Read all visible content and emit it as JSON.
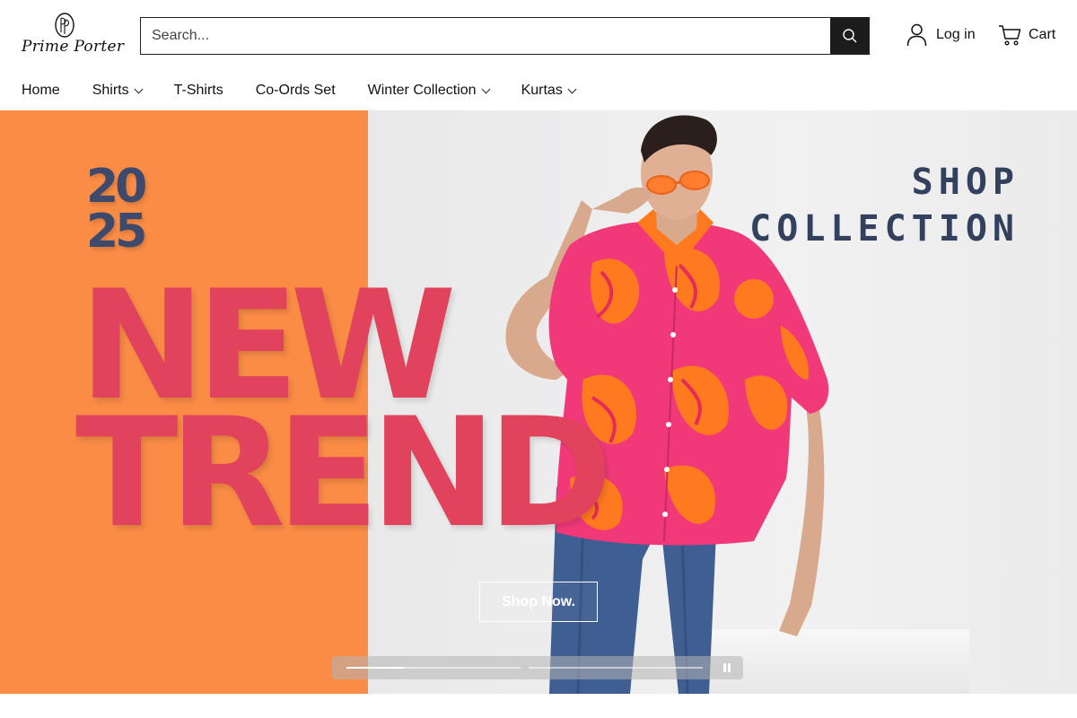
{
  "brand": {
    "name": "Prime Porter",
    "monogram": "PP"
  },
  "search": {
    "placeholder": "Search..."
  },
  "header": {
    "login_label": "Log in",
    "cart_label": "Cart"
  },
  "nav": {
    "items": [
      {
        "label": "Home"
      },
      {
        "label": "Shirts"
      },
      {
        "label": "T-Shirts"
      },
      {
        "label": "Co-Ords Set"
      },
      {
        "label": "Winter Collection"
      },
      {
        "label": "Kurtas"
      }
    ]
  },
  "hero": {
    "year_top": "20",
    "year_bottom": "25",
    "headline_line1": "NEW",
    "headline_line2": "TREND",
    "tag_line1": "SHOP",
    "tag_line2": "COLLECTION",
    "cta_label": "Shop Now.",
    "slides": {
      "count": 2,
      "current": 1,
      "progress": 0.33
    }
  },
  "colors": {
    "hero_left": "#fa8c46",
    "headline": "#e0435b",
    "accent_navy": "#33415e",
    "search_button": "#1c1c1c"
  }
}
